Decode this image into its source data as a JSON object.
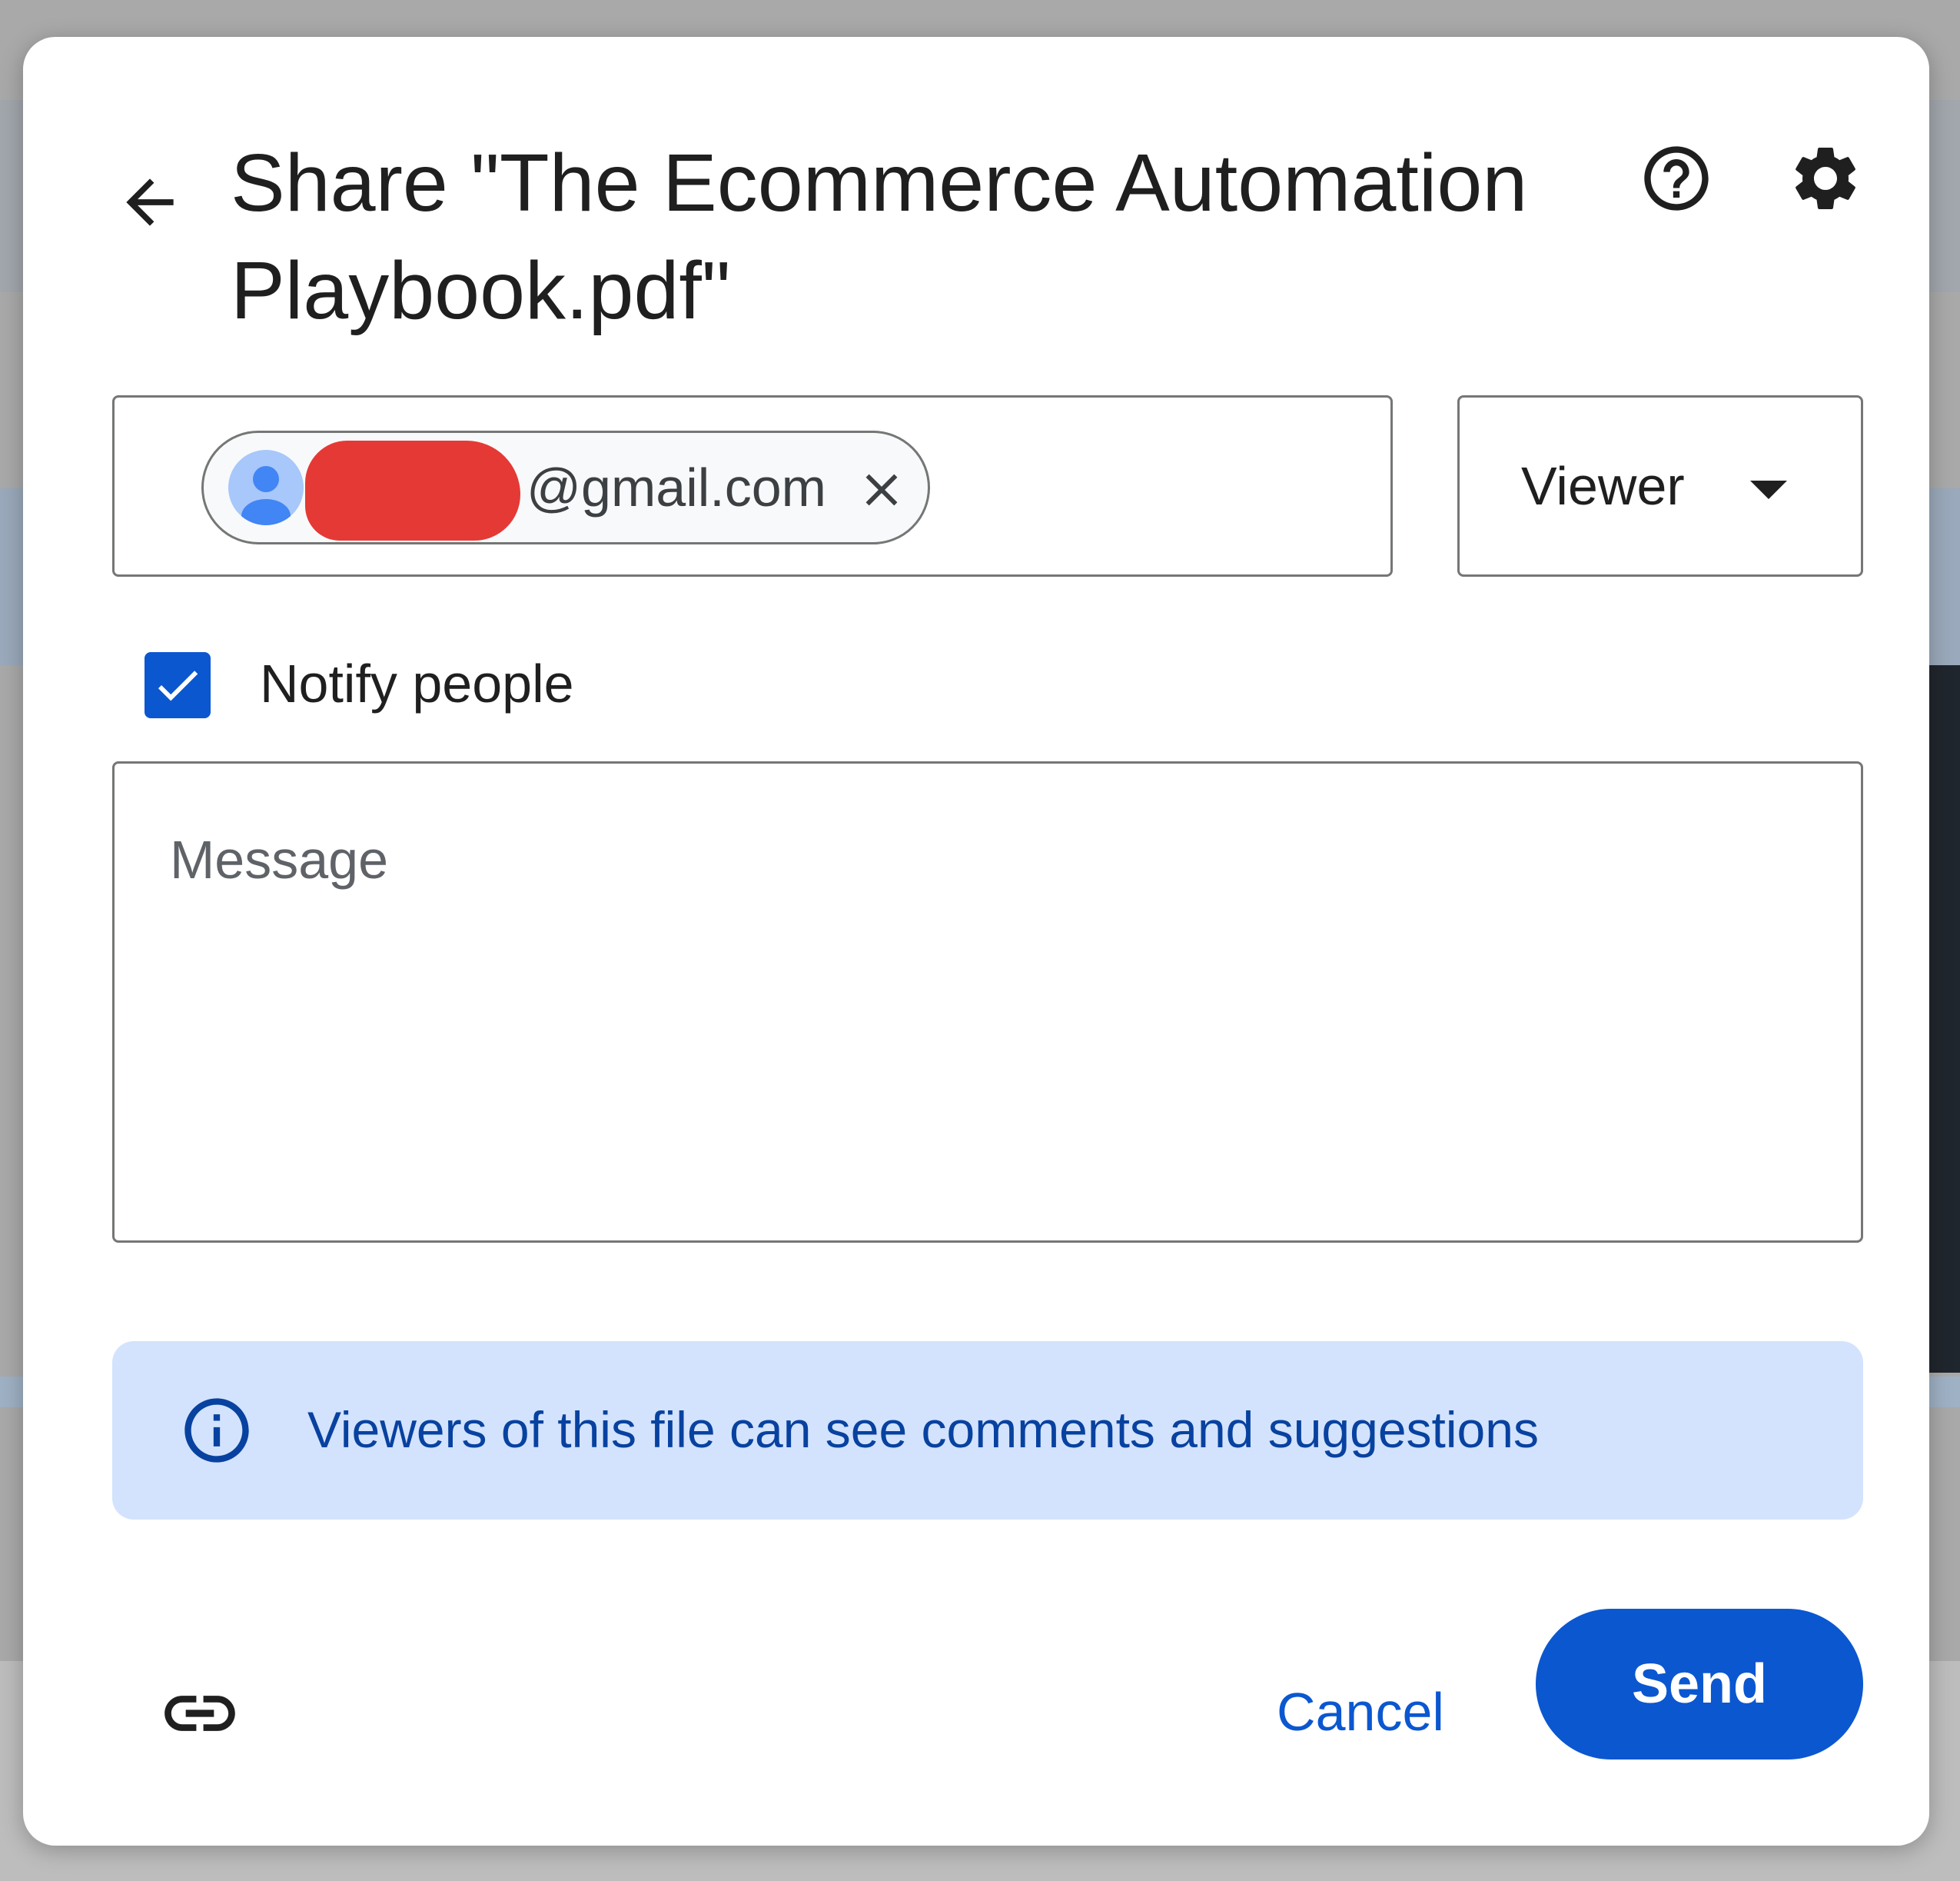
{
  "dialog": {
    "title": "Share \"The Ecommerce Automation Playbook.pdf\"",
    "icons": {
      "back": "arrow-back-icon",
      "help": "help-icon",
      "settings": "gear-icon",
      "remove": "close-icon",
      "info": "info-icon",
      "link": "link-icon"
    }
  },
  "recipients": [
    {
      "email": "@gmail.com",
      "redacted": true
    }
  ],
  "role": {
    "selected": "Viewer"
  },
  "notify": {
    "label": "Notify people",
    "checked": true
  },
  "message": {
    "placeholder": "Message",
    "value": ""
  },
  "info_banner": {
    "text": "Viewers of this file can see comments and suggestions"
  },
  "actions": {
    "cancel_label": "Cancel",
    "send_label": "Send"
  },
  "colors": {
    "primary": "#0b57d0",
    "banner_bg": "#d3e3fd",
    "banner_text": "#0842a0",
    "redaction": "#e53935"
  }
}
